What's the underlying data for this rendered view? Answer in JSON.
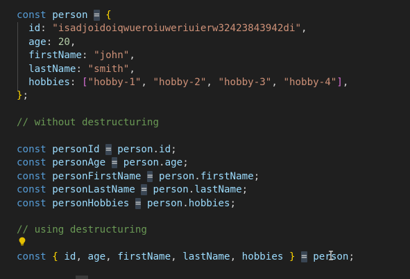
{
  "code": {
    "line1": {
      "kw": "const",
      "name": "person",
      "op": "=",
      "brace": "{"
    },
    "line2": {
      "prop": "id",
      "value": "\"isadjoidoiqwueroiuweriuierw32423843942di\""
    },
    "line3": {
      "prop": "age",
      "value": "20"
    },
    "line4": {
      "prop": "firstName",
      "value": "\"john\""
    },
    "line5": {
      "prop": "lastName",
      "value": "\"smith\""
    },
    "line6": {
      "prop": "hobbies",
      "values": [
        "\"hobby-1\"",
        "\"hobby-2\"",
        "\"hobby-3\"",
        "\"hobby-4\""
      ]
    },
    "line7": {
      "brace": "}",
      "semi": ";"
    },
    "comment1": "// without destructuring",
    "assignments": [
      {
        "kw": "const",
        "name": "personId",
        "op": "=",
        "obj": "person",
        "prop": "id"
      },
      {
        "kw": "const",
        "name": "personAge",
        "op": "=",
        "obj": "person",
        "prop": "age"
      },
      {
        "kw": "const",
        "name": "personFirstName",
        "op": "=",
        "obj": "person",
        "prop": "firstName"
      },
      {
        "kw": "const",
        "name": "personLastName",
        "op": "=",
        "obj": "person",
        "prop": "lastName"
      },
      {
        "kw": "const",
        "name": "personHobbies",
        "op": "=",
        "obj": "person",
        "prop": "hobbies"
      }
    ],
    "comment2": "// using destructuring",
    "destructure": {
      "kw": "const",
      "open": "{",
      "names": [
        "id",
        "age",
        "firstName",
        "lastName",
        "hobbies"
      ],
      "close": "}",
      "op": "=",
      "obj_a": "pe",
      "obj_b": "rson",
      "semi": ";"
    }
  },
  "icons": {
    "lightbulb": "lightbulb-icon",
    "text_cursor": "text-cursor-icon"
  },
  "colors": {
    "background": "#1f1f1f",
    "keyword": "#569cd6",
    "variable": "#9cdcfe",
    "string": "#ce9178",
    "number": "#b5cea8",
    "comment": "#6a9955",
    "brace": "#ffd700",
    "bracket": "#da70d6",
    "highlight": "#3a4654"
  }
}
